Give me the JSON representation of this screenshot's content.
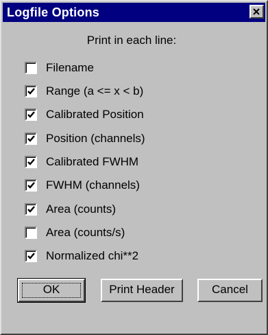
{
  "window": {
    "title": "Logfile Options"
  },
  "heading": "Print in each line:",
  "options": [
    {
      "label": "Filename",
      "checked": false
    },
    {
      "label": "Range (a <= x < b)",
      "checked": true
    },
    {
      "label": "Calibrated Position",
      "checked": true
    },
    {
      "label": "Position (channels)",
      "checked": true
    },
    {
      "label": "Calibrated FWHM",
      "checked": true
    },
    {
      "label": "FWHM (channels)",
      "checked": true
    },
    {
      "label": "Area (counts)",
      "checked": true
    },
    {
      "label": "Area (counts/s)",
      "checked": false
    },
    {
      "label": "Normalized chi**2",
      "checked": true
    }
  ],
  "buttons": {
    "ok": "OK",
    "print_header": "Print Header",
    "cancel": "Cancel"
  },
  "colors": {
    "titlebar": "#000080",
    "face": "#c0c0c0"
  }
}
